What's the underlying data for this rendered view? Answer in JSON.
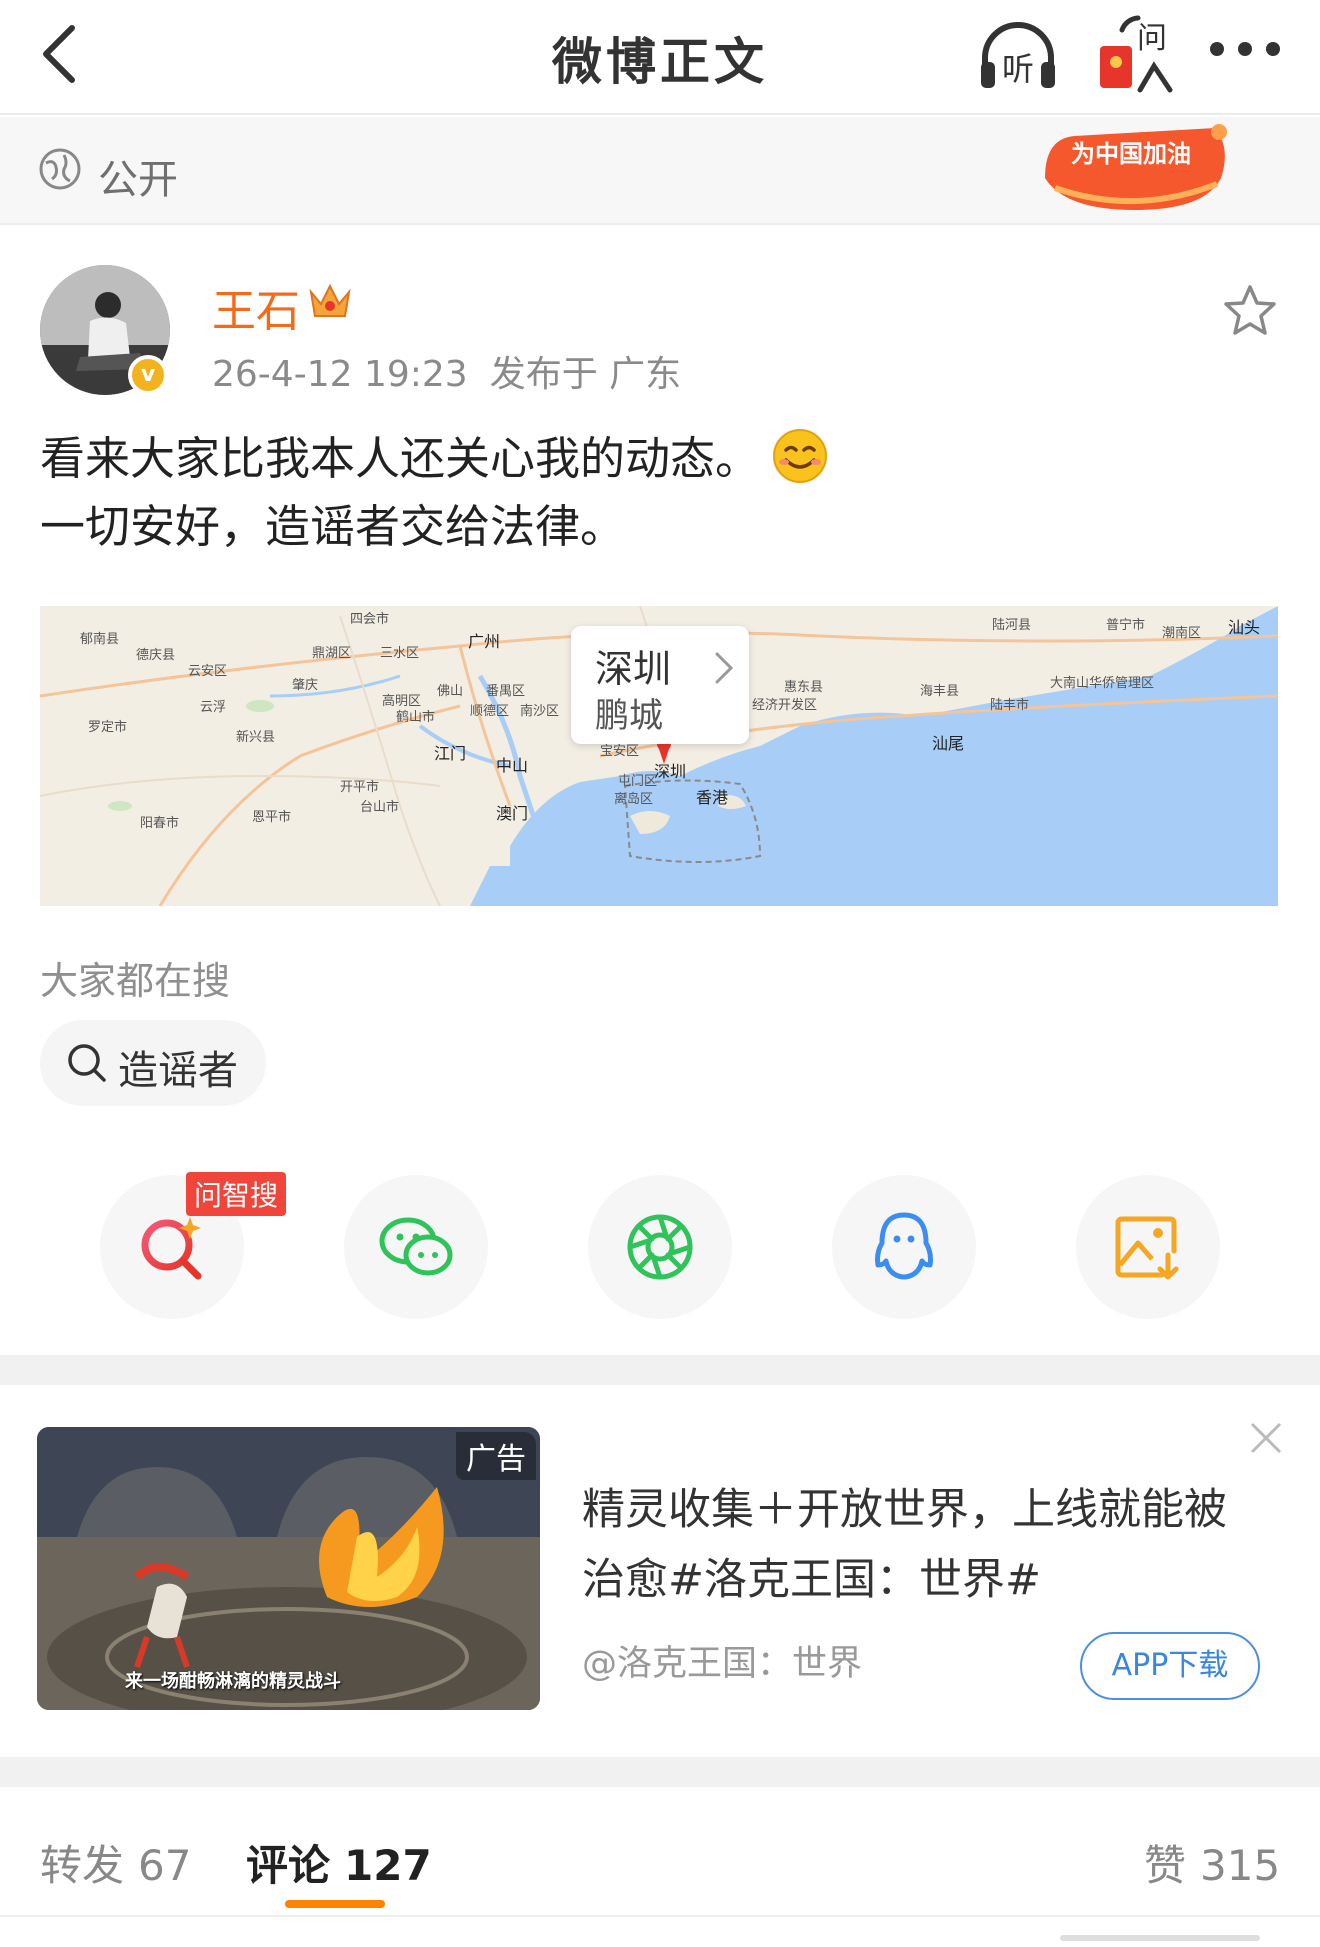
{
  "nav": {
    "title": "微博正文",
    "listen_icon": "headphones-icon",
    "listen_label": "听",
    "ask_icon": "red-envelope-ask-icon",
    "ask_label": "问",
    "more_icon": "more-dots-icon"
  },
  "visibility": {
    "icon": "globe-icon",
    "label": "公开",
    "badge_text": "为中国加油"
  },
  "author": {
    "name": "王石",
    "verified_mark": "v",
    "time": "26-4-12 19:23",
    "location": "发布于 广东",
    "name_color": "#f26b1d"
  },
  "post": {
    "line1": "看来大家比我本人还关心我的动态。",
    "line2": "一切安好，造谣者交给法律。",
    "emoji": "smile-emoji"
  },
  "map": {
    "callout_city": "深圳",
    "callout_sub": "鹏城",
    "labels": {
      "guangzhou": "广州",
      "foshan": "佛山",
      "zhaoqing": "肇庆",
      "jiangmen": "江门",
      "zhongshan": "中山",
      "macau": "澳门",
      "shenzhen": "深圳",
      "hongkong": "香港",
      "sihui": "四会市",
      "yunfu": "云浮",
      "luoding": "罗定市",
      "xinxing": "新兴县",
      "heshan": "鹤山市",
      "kaiping": "开平市",
      "taishan": "台山市",
      "enping": "恩平市",
      "yangchun": "阳春市",
      "shanwei": "汕尾",
      "lufeng": "陆丰市",
      "haifeng": "海丰县",
      "luhe": "陆河县",
      "puning": "普宁市",
      "chaonan": "潮南区",
      "shantou": "汕头",
      "dananshan": "大南山华侨管理区",
      "deqing": "德庆县",
      "yunan": "郁南县",
      "yunanqu": "云安区",
      "dinghu": "鼎湖区",
      "sanshui": "三水区",
      "gaoming": "高明区",
      "panyu": "番禺区",
      "shunde": "顺德区",
      "nansha": "南沙区",
      "baoan": "宝安区",
      "tuenmun": "屯门区",
      "lantau": "离岛区",
      "huidong": "惠东县",
      "jingji": "经济开发区"
    }
  },
  "trending": {
    "title": "大家都在搜",
    "chip": "造谣者"
  },
  "share": {
    "ask_tag": "问智搜",
    "items": [
      "ask-search-icon",
      "wechat-icon",
      "moments-icon",
      "qq-icon",
      "save-image-icon"
    ]
  },
  "ad": {
    "tag": "广告",
    "caption": "来一场酣畅淋漓的精灵战斗",
    "title": "精灵收集＋开放世界，上线就能被治愈#洛克王国：世界#",
    "source": "@洛克王国：世界",
    "button": "APP下载"
  },
  "tabs": {
    "repost_label": "转发",
    "repost_count": "67",
    "comment_label": "评论",
    "comment_count": "127",
    "like_label": "赞",
    "like_count": "315"
  },
  "colors": {
    "accent": "#ff8200",
    "link_blue": "#3a86e0",
    "wechat_green": "#2fc35a",
    "qq_blue": "#3b8ef0",
    "save_orange": "#f5a623",
    "ask_red": "#f0453a"
  }
}
